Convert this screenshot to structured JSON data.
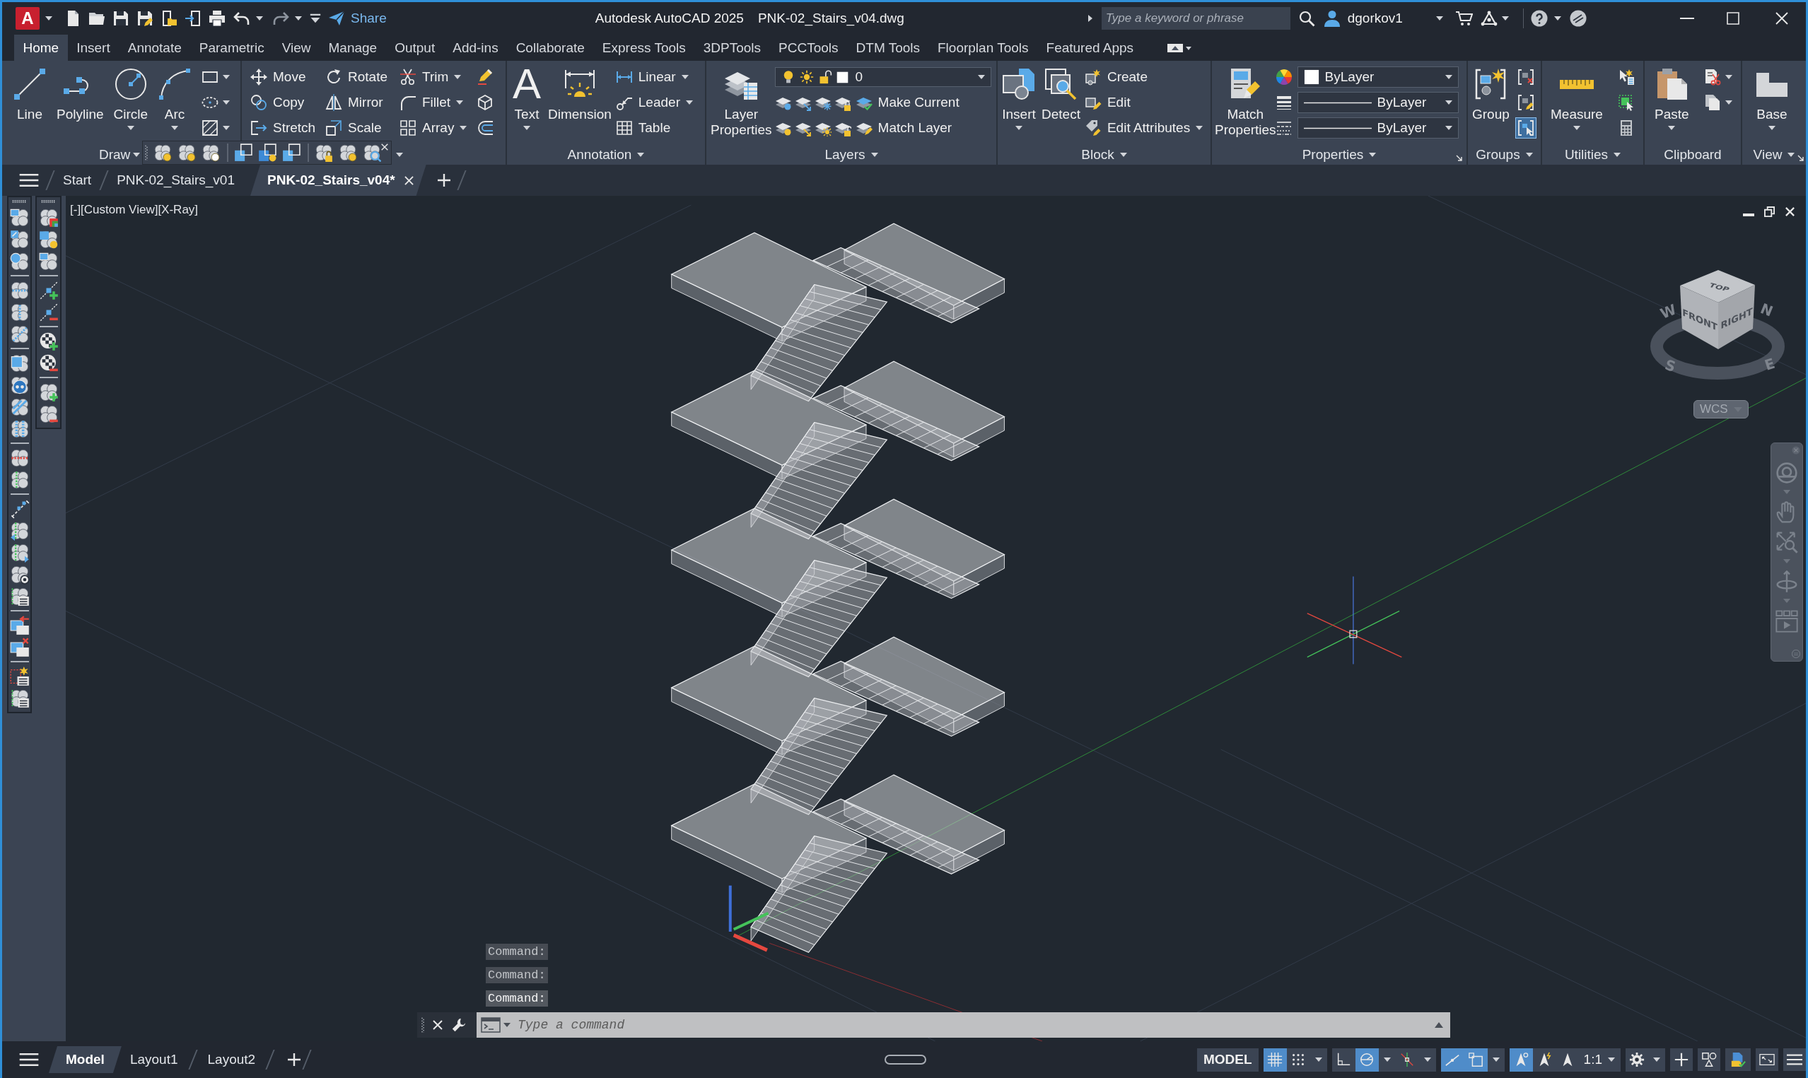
{
  "title_bar": {
    "app_button": "A",
    "share_label": "Share",
    "app_name": "Autodesk AutoCAD 2025",
    "file_name": "PNK-02_Stairs_v04.dwg",
    "search": {
      "placeholder": "Type a keyword or phrase"
    },
    "user_name": "dgorkov1"
  },
  "ribbon": {
    "tabs": [
      {
        "label": "Home",
        "selected": true
      },
      {
        "label": "Insert",
        "selected": false
      },
      {
        "label": "Annotate",
        "selected": false
      },
      {
        "label": "Parametric",
        "selected": false
      },
      {
        "label": "View",
        "selected": false
      },
      {
        "label": "Manage",
        "selected": false
      },
      {
        "label": "Output",
        "selected": false
      },
      {
        "label": "Add-ins",
        "selected": false
      },
      {
        "label": "Collaborate",
        "selected": false
      },
      {
        "label": "Express Tools",
        "selected": false
      },
      {
        "label": "3DPTools",
        "selected": false
      },
      {
        "label": "PCCTools",
        "selected": false
      },
      {
        "label": "DTM Tools",
        "selected": false
      },
      {
        "label": "Floorplan Tools",
        "selected": false
      },
      {
        "label": "Featured Apps",
        "selected": false
      }
    ],
    "draw": {
      "title": "Draw",
      "title_menu": true,
      "tools": [
        {
          "label": "Line",
          "dropdown": false
        },
        {
          "label": "Polyline",
          "dropdown": false
        },
        {
          "label": "Circle",
          "dropdown": true
        },
        {
          "label": "Arc",
          "dropdown": true
        }
      ]
    },
    "modify": {
      "title_menu": true,
      "tools": [
        {
          "label": "Move",
          "dropdown": false
        },
        {
          "label": "Rotate",
          "dropdown": false
        },
        {
          "label": "Trim",
          "dropdown": true
        },
        {
          "label": "Copy",
          "dropdown": false
        },
        {
          "label": "Mirror",
          "dropdown": false
        },
        {
          "label": "Fillet",
          "dropdown": true
        },
        {
          "label": "Stretch",
          "dropdown": false
        },
        {
          "label": "Scale",
          "dropdown": false
        },
        {
          "label": "Array",
          "dropdown": true
        }
      ]
    },
    "annotation": {
      "title": "Annotation",
      "title_menu": true,
      "text_tool": {
        "glyph": "A",
        "label": "Text",
        "dropdown": true
      },
      "dimension_tool": {
        "label": "Dimension",
        "dropdown": false
      },
      "small_tools": [
        {
          "label": "Linear",
          "dropdown": true
        },
        {
          "label": "Leader",
          "dropdown": true
        },
        {
          "label": "Table",
          "dropdown": false
        }
      ]
    },
    "layers": {
      "title": "Layers",
      "title_menu": true,
      "properties_label": "Layer Properties",
      "current_layer": "0",
      "make_current_label": "Make Current",
      "match_layer_label": "Match Layer"
    },
    "block": {
      "title": "Block",
      "title_menu": true,
      "large_tools": [
        {
          "label": "Insert",
          "dropdown": true
        },
        {
          "label": "Detect",
          "dropdown": false
        }
      ],
      "small_tools": [
        {
          "label": "Create",
          "dropdown": false
        },
        {
          "label": "Edit",
          "dropdown": false
        },
        {
          "label": "Edit Attributes",
          "dropdown": true
        }
      ]
    },
    "properties": {
      "title": "Properties",
      "title_menu": true,
      "match_label": "Match Properties",
      "object_color": "ByLayer",
      "lineweight": "ByLayer",
      "linetype": "ByLayer"
    },
    "groups": {
      "title": "Groups",
      "title_menu": true,
      "group_label": "Group",
      "group_selection": {
        "on": true
      }
    },
    "utilities": {
      "title": "Utilities",
      "title_menu": true,
      "measure": {
        "label": "Measure",
        "dropdown": true
      }
    },
    "clipboard": {
      "title": "Clipboard",
      "title_menu": false,
      "paste": {
        "label": "Paste",
        "dropdown": true
      }
    },
    "view": {
      "title": "View",
      "title_menu": true,
      "base": {
        "label": "Base",
        "dropdown": true
      }
    }
  },
  "file_tabs": [
    {
      "label": "Start",
      "selected": false
    },
    {
      "label": "PNK-02_Stairs_v01",
      "selected": false
    },
    {
      "label": "PNK-02_Stairs_v04*",
      "selected": true
    }
  ],
  "viewport": {
    "label": "[-][Custom View][X-Ray]",
    "view_cube": {
      "top": "TOP",
      "front": "FRONT",
      "right": "RIGHT",
      "north": "N",
      "east": "E",
      "south": "S",
      "west": "W"
    },
    "coordinate_system": "WCS"
  },
  "command_line": {
    "history": [
      {
        "text": "Command:",
        "faded": true
      },
      {
        "text": "Command:",
        "faded": true
      },
      {
        "text": "Command:",
        "faded": false
      }
    ],
    "input": {
      "placeholder": "Type a command"
    }
  },
  "layout_tabs": [
    {
      "label": "Model",
      "selected": true
    },
    {
      "label": "Layout1",
      "selected": false
    },
    {
      "label": "Layout2",
      "selected": false
    }
  ],
  "status_bar": {
    "space_label": "MODEL",
    "toggles": [
      {
        "on": true
      },
      {
        "on": false
      },
      {
        "on": false
      },
      {
        "on": true
      },
      {
        "on": false
      },
      {
        "on": true
      },
      {
        "on": true
      },
      {
        "on": true
      },
      {
        "on": false
      },
      {
        "on": false
      }
    ],
    "annotation_scale": "1:1"
  }
}
